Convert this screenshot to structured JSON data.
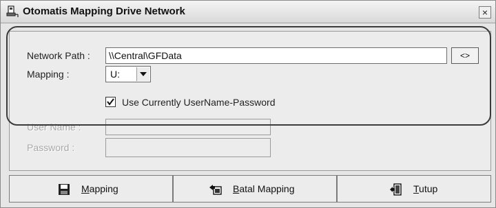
{
  "window": {
    "title": "Otomatis Mapping Drive Network",
    "close_glyph": "×",
    "app_icon": "network-drive-icon"
  },
  "form": {
    "network_path_label": "Network Path :",
    "network_path_value": "\\\\Central\\GFData",
    "browse_label": "<>",
    "mapping_label": "Mapping :",
    "mapping_value": "U:",
    "use_current_label": "Use Currently UserName-Password",
    "use_current_checked": true,
    "username_label": "User Name :",
    "username_value": "",
    "password_label": "Password :",
    "password_value": ""
  },
  "buttons": {
    "mapping_label": "Mapping",
    "batal_label": "Batal Mapping",
    "tutup_label": "Tutup"
  }
}
